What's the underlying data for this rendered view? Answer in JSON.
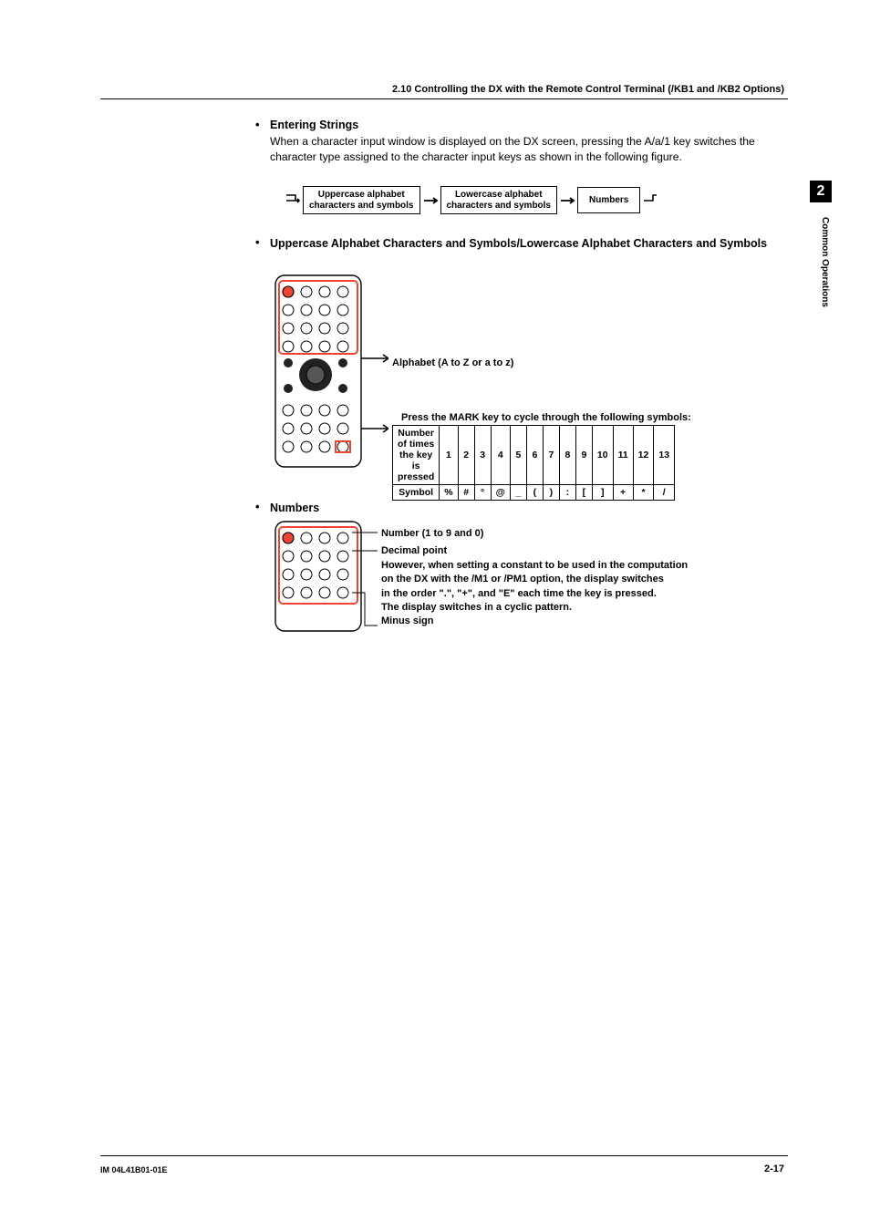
{
  "chapter_tab": "2",
  "side_label": "Common Operations",
  "section_header": "2.10  Controlling the DX with the Remote Control Terminal (/KB1 and /KB2 Options)",
  "b1_title": "Entering Strings",
  "b1_text": "When a character input window is displayed on the DX screen, pressing the A/a/1 key switches the character type assigned to the character input keys as shown in the following figure.",
  "flow": {
    "box1_l1": "Uppercase alphabet",
    "box1_l2": "characters and symbols",
    "box2_l1": "Lowercase alphabet",
    "box2_l2": "characters and symbols",
    "box3": "Numbers"
  },
  "b2_title": "Uppercase Alphabet Characters and Symbols/Lowercase Alphabet Characters and Symbols",
  "alpha_label": "Alphabet (A to Z or a to z)",
  "mark_label": "Press the MARK key to cycle through the following symbols:",
  "table": {
    "row1_label_l1": "Number of times",
    "row1_label_l2": "the key is pressed",
    "nums": [
      "1",
      "2",
      "3",
      "4",
      "5",
      "6",
      "7",
      "8",
      "9",
      "10",
      "11",
      "12",
      "13"
    ],
    "row2_label": "Symbol",
    "syms": [
      "%",
      "#",
      "°",
      "@",
      "_",
      "(",
      ")",
      ":",
      "[",
      "]",
      "+",
      "*",
      "/"
    ]
  },
  "b3_title": "Numbers",
  "numbers": {
    "l1": "Number (1 to 9 and 0)",
    "l2": "Decimal point",
    "l3a": "However, when setting a constant to be used in the computation",
    "l3b": "on the DX with the /M1 or /PM1 option, the display switches",
    "l3c": "in the order \".\", \"+\", and \"E\" each time the key is pressed.",
    "l3d": "The display switches in a cyclic pattern.",
    "l4": "Minus sign"
  },
  "footer_left": "IM 04L41B01-01E",
  "footer_right": "2-17"
}
